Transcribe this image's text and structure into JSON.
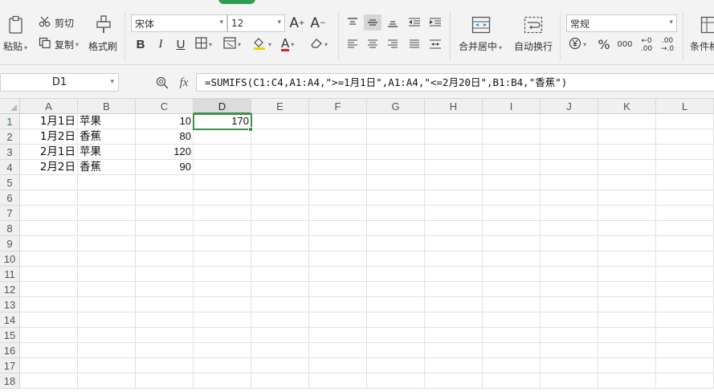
{
  "ribbon": {
    "paste_label": "粘贴",
    "cut_label": "剪切",
    "copy_label": "复制",
    "format_painter_label": "格式刷",
    "font_name": "宋体",
    "font_size": "12",
    "bold": "B",
    "italic": "I",
    "underline": "U",
    "font_color_glyph": "A",
    "merge_center_label": "合并居中",
    "wrap_text_label": "自动换行",
    "number_format": "常规",
    "percent": "%",
    "thousands": "000",
    "inc_decimal_top": "←0",
    "inc_decimal_bottom": ".00",
    "dec_decimal_top": ".00",
    "dec_decimal_bottom": "→.0",
    "conditional_format_label": "条件格"
  },
  "formula_bar": {
    "name_box": "D1",
    "fx": "fx",
    "formula": "=SUMIFS(C1:C4,A1:A4,\">=1月1日\",A1:A4,\"<=2月20日\",B1:B4,\"香蕉\")"
  },
  "sheet": {
    "columns": [
      "A",
      "B",
      "C",
      "D",
      "E",
      "F",
      "G",
      "H",
      "I",
      "J",
      "K",
      "L"
    ],
    "rows": [
      "1",
      "2",
      "3",
      "4",
      "5",
      "6",
      "7",
      "8",
      "9",
      "10",
      "11",
      "12",
      "13",
      "14",
      "15",
      "16",
      "17",
      "18"
    ],
    "data": [
      [
        "1月1日",
        "苹果",
        "10",
        "170"
      ],
      [
        "1月2日",
        "香蕉",
        "80",
        ""
      ],
      [
        "2月1日",
        "苹果",
        "120",
        ""
      ],
      [
        "2月2日",
        "香蕉",
        "90",
        ""
      ]
    ],
    "selected_cell": "D1",
    "selected_column": "D",
    "selected_row": "1",
    "accent_color": "#3e8f4a"
  }
}
